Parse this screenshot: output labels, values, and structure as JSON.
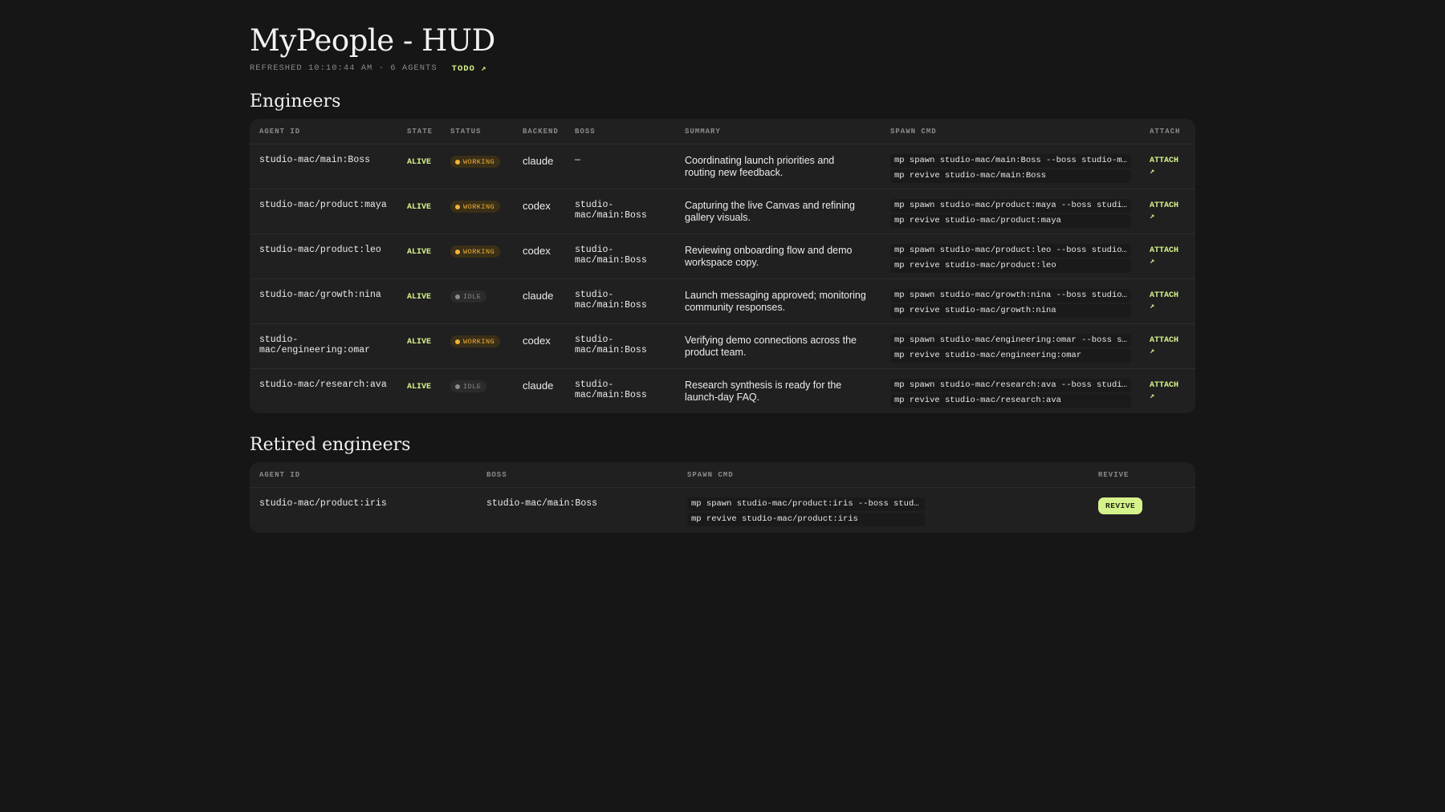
{
  "header": {
    "title": "MyPeople - HUD",
    "refreshed": "REFRESHED 10:10:44 AM · 6 AGENTS",
    "todo_link": "TODO ↗"
  },
  "engineers": {
    "title": "Engineers",
    "columns": [
      "AGENT ID",
      "STATE",
      "STATUS",
      "BACKEND",
      "BOSS",
      "SUMMARY",
      "SPAWN CMD",
      "ATTACH"
    ],
    "rows": [
      {
        "agent_id": "studio-mac/main:Boss",
        "state": "ALIVE",
        "status": "WORKING",
        "status_kind": "working",
        "backend": "claude",
        "boss": "—",
        "summary": "Coordinating launch priorities and routing new feedback.",
        "spawn_cmd": "mp spawn studio-mac/main:Boss --boss studio-mac/main:Boss",
        "revive_cmd": "mp revive studio-mac/main:Boss",
        "attach": "ATTACH ↗"
      },
      {
        "agent_id": "studio-mac/product:maya",
        "state": "ALIVE",
        "status": "WORKING",
        "status_kind": "working",
        "backend": "codex",
        "boss": "studio-mac/main:Boss",
        "summary": "Capturing the live Canvas and refining gallery visuals.",
        "spawn_cmd": "mp spawn studio-mac/product:maya --boss studio-mac/main:Boss",
        "revive_cmd": "mp revive studio-mac/product:maya",
        "attach": "ATTACH ↗"
      },
      {
        "agent_id": "studio-mac/product:leo",
        "state": "ALIVE",
        "status": "WORKING",
        "status_kind": "working",
        "backend": "codex",
        "boss": "studio-mac/main:Boss",
        "summary": "Reviewing onboarding flow and demo workspace copy.",
        "spawn_cmd": "mp spawn studio-mac/product:leo --boss studio-mac/main:Boss",
        "revive_cmd": "mp revive studio-mac/product:leo",
        "attach": "ATTACH ↗"
      },
      {
        "agent_id": "studio-mac/growth:nina",
        "state": "ALIVE",
        "status": "IDLE",
        "status_kind": "idle",
        "backend": "claude",
        "boss": "studio-mac/main:Boss",
        "summary": "Launch messaging approved; monitoring community responses.",
        "spawn_cmd": "mp spawn studio-mac/growth:nina --boss studio-mac/main:Boss",
        "revive_cmd": "mp revive studio-mac/growth:nina",
        "attach": "ATTACH ↗"
      },
      {
        "agent_id": "studio-mac/engineering:omar",
        "state": "ALIVE",
        "status": "WORKING",
        "status_kind": "working",
        "backend": "codex",
        "boss": "studio-mac/main:Boss",
        "summary": "Verifying demo connections across the product team.",
        "spawn_cmd": "mp spawn studio-mac/engineering:omar --boss studio-mac/main:Boss",
        "revive_cmd": "mp revive studio-mac/engineering:omar",
        "attach": "ATTACH ↗"
      },
      {
        "agent_id": "studio-mac/research:ava",
        "state": "ALIVE",
        "status": "IDLE",
        "status_kind": "idle",
        "backend": "claude",
        "boss": "studio-mac/main:Boss",
        "summary": "Research synthesis is ready for the launch-day FAQ.",
        "spawn_cmd": "mp spawn studio-mac/research:ava --boss studio-mac/main:Boss",
        "revive_cmd": "mp revive studio-mac/research:ava",
        "attach": "ATTACH ↗"
      }
    ]
  },
  "retired": {
    "title": "Retired engineers",
    "columns": [
      "AGENT ID",
      "BOSS",
      "SPAWN CMD",
      "REVIVE"
    ],
    "rows": [
      {
        "agent_id": "studio-mac/product:iris",
        "boss": "studio-mac/main:Boss",
        "spawn_cmd": "mp spawn studio-mac/product:iris --boss studio-mac/main:Boss",
        "revive_cmd": "mp revive studio-mac/product:iris",
        "revive_label": "REVIVE"
      }
    ]
  },
  "colors": {
    "background": "#161616",
    "card": "#202020",
    "accent_green": "#d6f28a",
    "working_orange": "#f3b13a",
    "idle_grey": "#8a8a8a"
  }
}
